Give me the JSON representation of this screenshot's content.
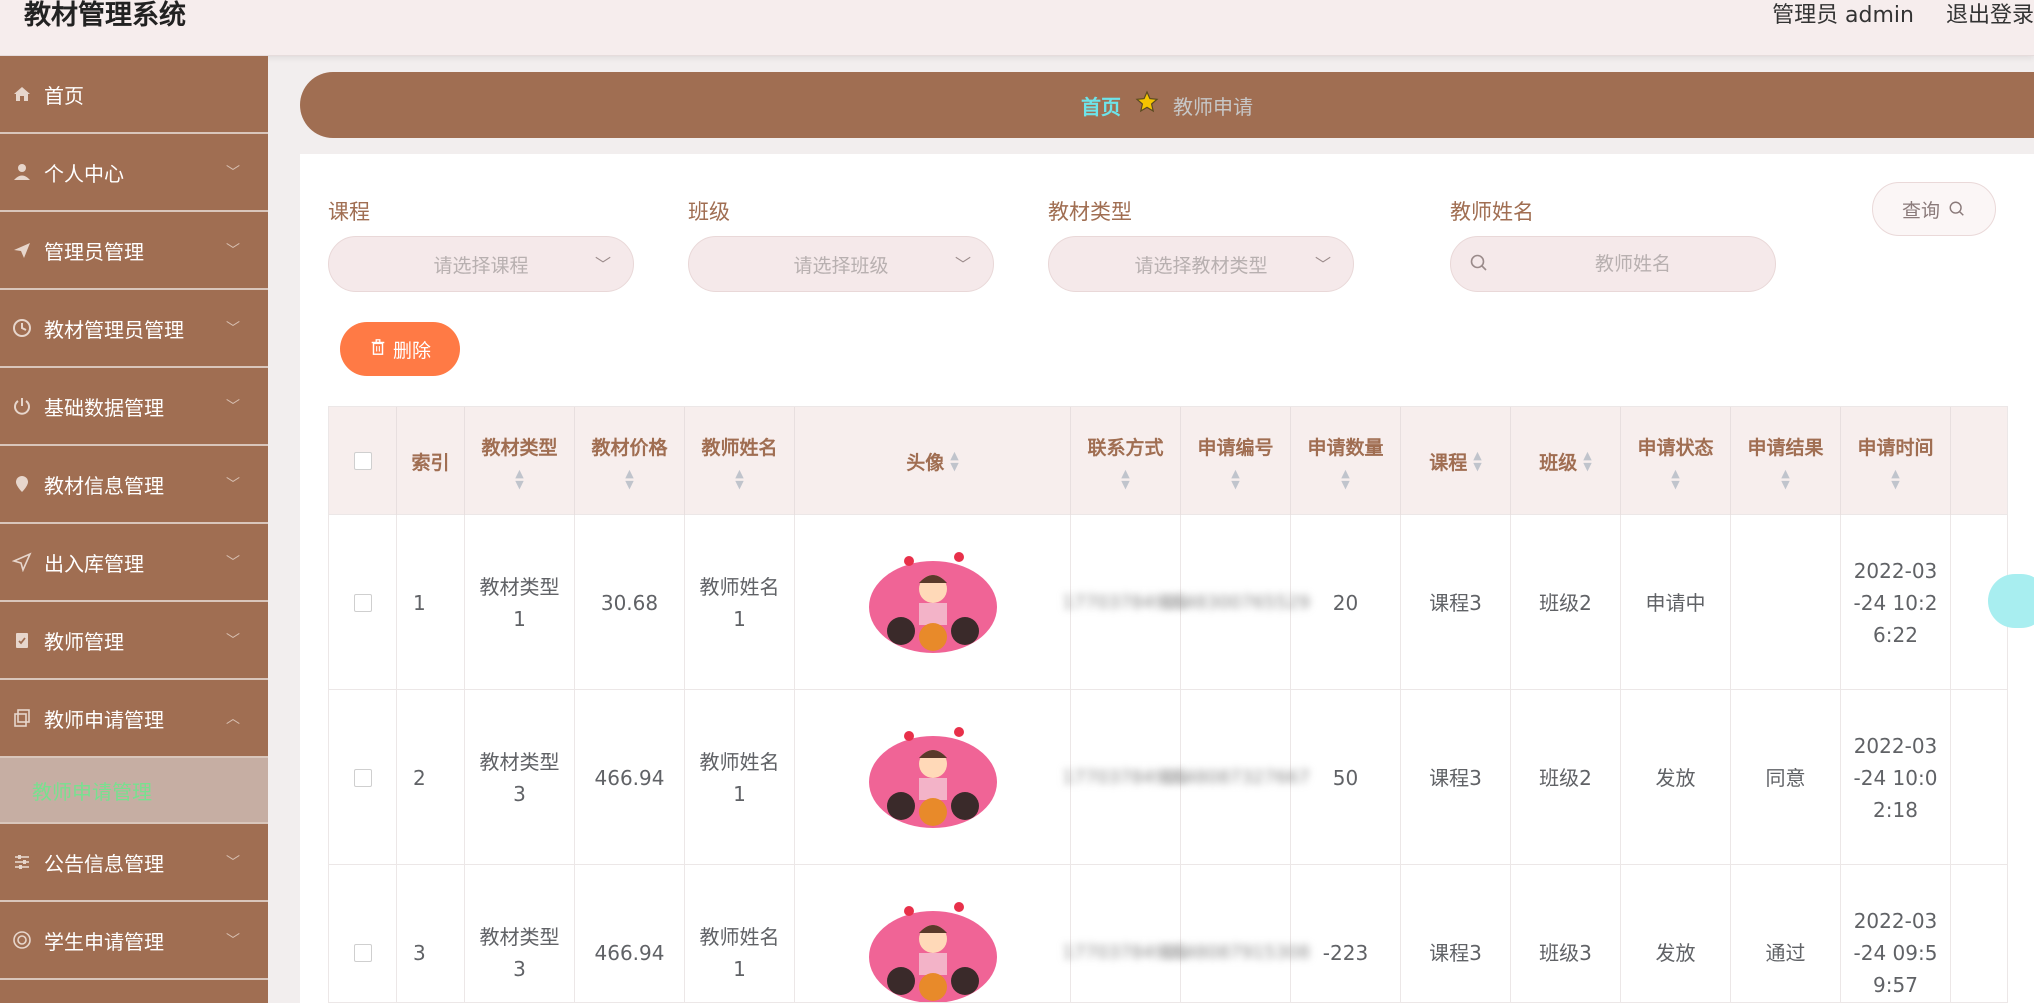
{
  "header": {
    "title": "教材管理系统",
    "user": "管理员 admin",
    "logout": "退出登录"
  },
  "sidebar": {
    "items": [
      {
        "label": "首页",
        "icon": "home-icon"
      },
      {
        "label": "个人中心",
        "icon": "user-icon"
      },
      {
        "label": "管理员管理",
        "icon": "paper-plane-icon"
      },
      {
        "label": "教材管理员管理",
        "icon": "clock-icon"
      },
      {
        "label": "基础数据管理",
        "icon": "power-icon"
      },
      {
        "label": "教材信息管理",
        "icon": "location-icon"
      },
      {
        "label": "出入库管理",
        "icon": "send-icon"
      },
      {
        "label": "教师管理",
        "icon": "clipboard-icon"
      },
      {
        "label": "教师申请管理",
        "icon": "copy-icon"
      },
      {
        "label": "公告信息管理",
        "icon": "sliders-icon"
      },
      {
        "label": "学生申请管理",
        "icon": "target-icon"
      }
    ],
    "active_submenu": "教师申请管理"
  },
  "breadcrumb": {
    "home": "首页",
    "current": "教师申请"
  },
  "filters": {
    "course_label": "课程",
    "course_placeholder": "请选择课程",
    "class_label": "班级",
    "class_placeholder": "请选择班级",
    "type_label": "教材类型",
    "type_placeholder": "请选择教材类型",
    "teacher_label": "教师姓名",
    "teacher_placeholder": "教师姓名",
    "query_label": "查询"
  },
  "actions": {
    "delete_label": "删除"
  },
  "table": {
    "columns": [
      "索引",
      "教材类型",
      "教材价格",
      "教师姓名",
      "头像",
      "联系方式",
      "申请编号",
      "申请数量",
      "课程",
      "班级",
      "申请状态",
      "申请结果",
      "申请时间"
    ],
    "rows": [
      {
        "index": "1",
        "type": "教材类型1",
        "price": "30.68",
        "teacher": "教师姓名1",
        "contact": "17703784901",
        "number": "1648300765529",
        "quantity": "20",
        "course": "课程3",
        "class": "班级2",
        "status": "申请中",
        "result": "",
        "time": "2022-03-24 10:26:22"
      },
      {
        "index": "2",
        "type": "教材类型3",
        "price": "466.94",
        "teacher": "教师姓名1",
        "contact": "17703784901",
        "number": "1648087327667",
        "quantity": "50",
        "course": "课程3",
        "class": "班级2",
        "status": "发放",
        "result": "同意",
        "time": "2022-03-24 10:02:18"
      },
      {
        "index": "3",
        "type": "教材类型3",
        "price": "466.94",
        "teacher": "教师姓名1",
        "contact": "17703784901",
        "number": "1648087915308",
        "quantity": "-223",
        "course": "课程3",
        "class": "班级3",
        "status": "发放",
        "result": "通过",
        "time": "2022-03-24 09:59:57"
      }
    ]
  },
  "colors": {
    "brand": "#a06e52",
    "accent_cyan": "#6de4ea",
    "delete_orange": "#ff7a45",
    "submenu_text": "#78e08f"
  }
}
